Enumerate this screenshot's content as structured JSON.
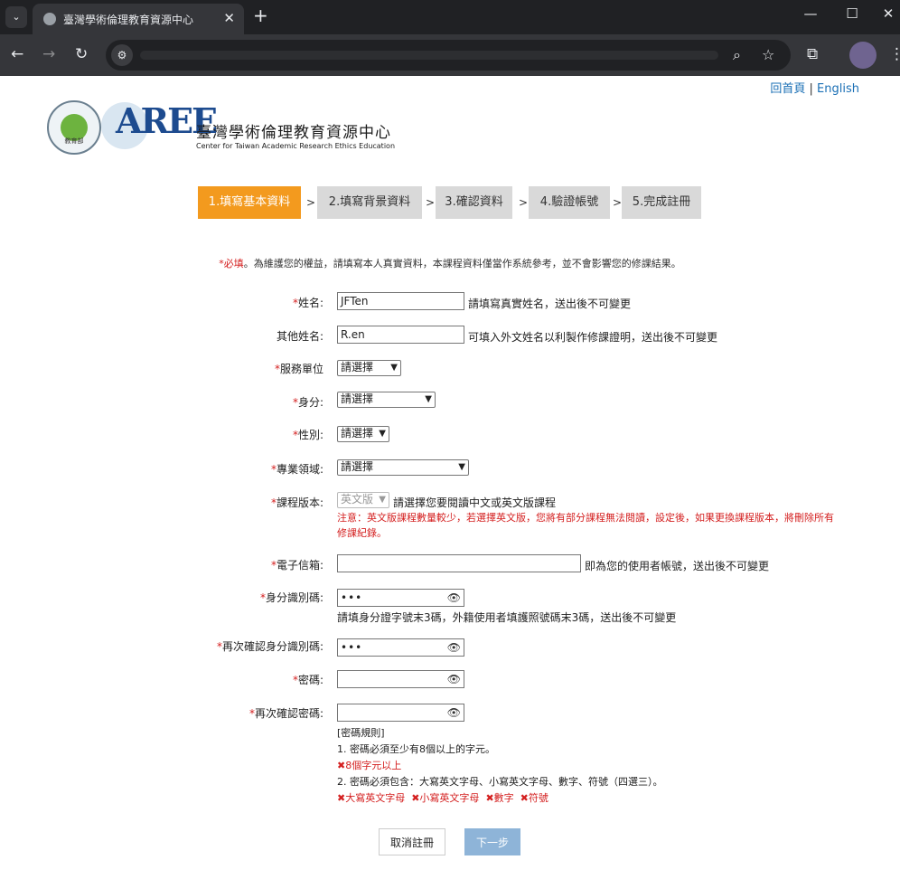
{
  "browser": {
    "tab_title": "臺灣學術倫理教育資源中心",
    "tab_close": "✕",
    "new_tab": "+",
    "min": "—",
    "max": "☐",
    "close": "✕"
  },
  "header": {
    "home_link": "回首頁",
    "separator": " | ",
    "english_link": "English",
    "moe_text": "教育部",
    "aree_mark": "AREE",
    "site_name": "臺灣學術倫理教育資源中心",
    "site_sub": "Center for Taiwan Academic Research Ethics Education"
  },
  "steps": [
    {
      "label": "1.填寫基本資料"
    },
    {
      "label": "2.填寫背景資料"
    },
    {
      "label": "3.確認資料"
    },
    {
      "label": "4.驗證帳號"
    },
    {
      "label": "5.完成註冊"
    }
  ],
  "step_separator": ">",
  "notice": {
    "required": "*必填",
    "text": "。為維護您的權益，請填寫本人真實資料，本課程資料僅當作系統參考，並不會影響您的修課結果。"
  },
  "form": {
    "name": {
      "label": "姓名:",
      "value": "JFTen",
      "hint": "請填寫真實姓名，送出後不可變更"
    },
    "other_name": {
      "label": "其他姓名:",
      "value": "R.en",
      "hint": "可填入外文姓名以利製作修課證明，送出後不可變更"
    },
    "unit": {
      "label": "服務單位",
      "selected": "請選擇"
    },
    "identity": {
      "label": "身分:",
      "selected": "請選擇"
    },
    "gender": {
      "label": "性別:",
      "selected": "請選擇"
    },
    "field": {
      "label": "專業領域:",
      "selected": "請選擇"
    },
    "course_version": {
      "label": "課程版本:",
      "selected": "英文版",
      "hint": "請選擇您要閱讀中文或英文版課程",
      "warning": "注意：英文版課程數量較少，若選擇英文版，您將有部分課程無法閱讀，設定後，如果更換課程版本，將刪除所有修課紀錄。"
    },
    "email": {
      "label": "電子信箱:",
      "value": "",
      "hint": "即為您的使用者帳號，送出後不可變更"
    },
    "id_code": {
      "label": "身分識別碼:",
      "value": "•••",
      "hint": "請填身分證字號末3碼，外籍使用者填護照號碼末3碼，送出後不可變更"
    },
    "id_code_confirm": {
      "label": "再次確認身分識別碼:",
      "value": "•••"
    },
    "password": {
      "label": "密碼:",
      "value": ""
    },
    "password_confirm": {
      "label": "再次確認密碼:",
      "value": ""
    }
  },
  "required_mark": "*",
  "eye_icon": "👁",
  "rules": {
    "title": "[密碼規則]",
    "rule1": "1. 密碼必須至少有8個以上的字元。",
    "rule1_status": "✖8個字元以上",
    "rule2": "2. 密碼必須包含：大寫英文字母、小寫英文字母、數字、符號（四選三）。",
    "rule2_status": [
      "✖大寫英文字母",
      "✖小寫英文字母",
      "✖數字",
      "✖符號"
    ]
  },
  "buttons": {
    "cancel": "取消註冊",
    "next": "下一步"
  },
  "colors": {
    "active_step": "#f39a1e",
    "inactive_step": "#d9d9d9",
    "required": "#d42020",
    "link": "#1a6fb5",
    "next_button": "#8eb4d8"
  }
}
